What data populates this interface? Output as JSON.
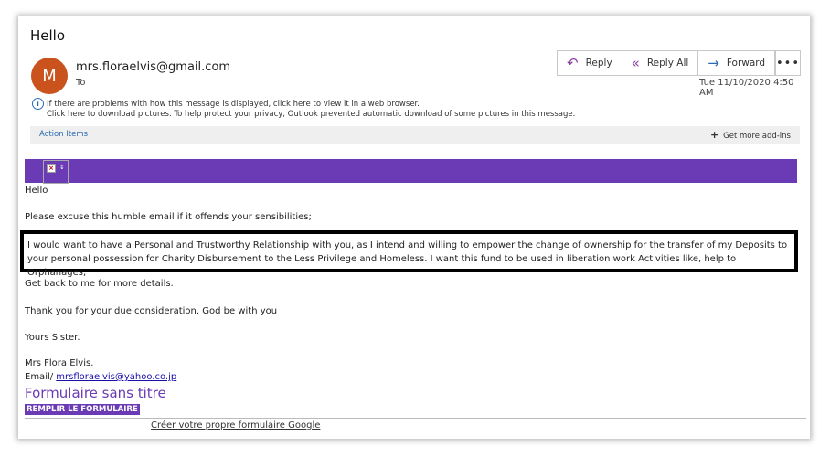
{
  "email": {
    "subject": "Hello",
    "avatar_letter": "M",
    "sender": "mrs.floraelvis@gmail.com",
    "to_label": "To",
    "date": "Tue 11/10/2020 4:50 AM"
  },
  "actions": {
    "reply": "Reply",
    "reply_all": "Reply All",
    "forward": "Forward",
    "more": "•••"
  },
  "info": {
    "line1": "If there are problems with how this message is displayed, click here to view it in a web browser.",
    "line2": "Click here to download pictures. To help protect your privacy, Outlook prevented automatic download of some pictures in this message."
  },
  "action_bar": {
    "action_items": "Action Items",
    "addins": "Get more add-ins"
  },
  "body": {
    "greeting": "Hello",
    "p1": "Please excuse this humble email if it offends your sensibilities;",
    "highlight": "I would want to have a Personal and Trustworthy Relationship with you, as I intend and willing to empower the change of ownership for the transfer of my Deposits to your personal possession for Charity Disbursement to the Less Privilege and Homeless. I want this fund to be used in liberation work Activities like, help to Orphanages,",
    "p2": "Get back to me for more details.",
    "p3": "Thank you for your due consideration. God be with you",
    "p4": "Yours Sister.",
    "signature_name": "Mrs Flora Elvis.",
    "email_label": "Email/ ",
    "email_link": "mrsfloraelvis@yahoo.co.jp"
  },
  "form": {
    "title": "Formulaire sans titre",
    "button": "REMPLIR LE FORMULAIRE",
    "create_link": "Créer votre propre formulaire Google"
  },
  "colors": {
    "accent_purple": "#6b3ab5",
    "avatar": "#c9521d",
    "link_blue": "#2b6cb0"
  }
}
